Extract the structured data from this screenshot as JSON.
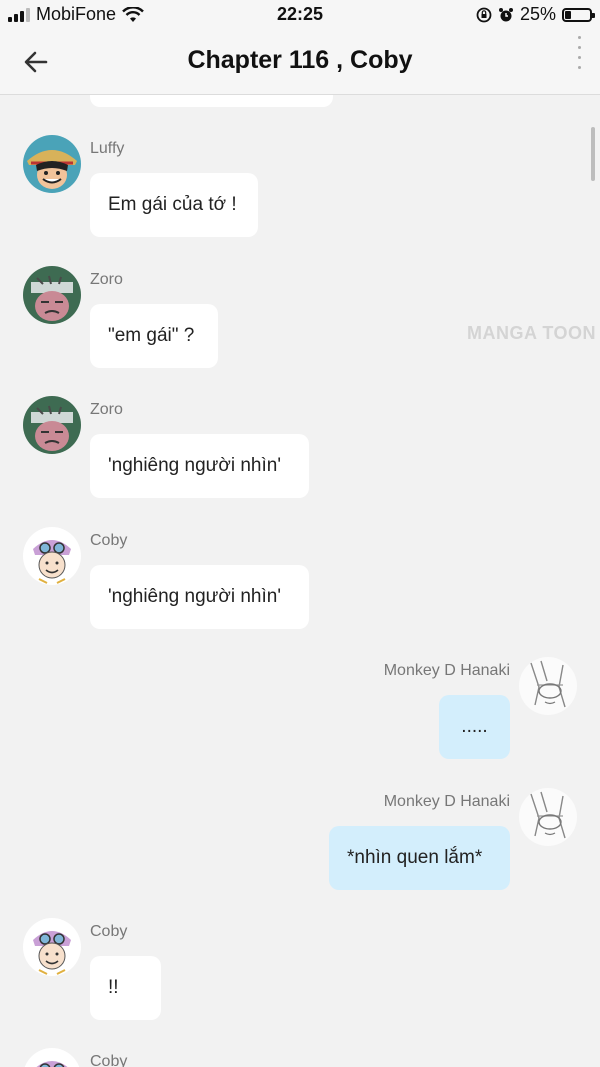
{
  "status_bar": {
    "carrier": "MobiFone",
    "time": "22:25",
    "battery_percent": "25%",
    "battery_level": 0.25
  },
  "header": {
    "title": "Chapter 116 , Coby"
  },
  "watermark": "MANGA TOON",
  "messages": [
    {
      "sender": "Luffy",
      "text": "Em gái của tớ !",
      "mine": false
    },
    {
      "sender": "Zoro",
      "text": "\"em gái\" ?",
      "mine": false
    },
    {
      "sender": "Zoro",
      "text": "'nghiêng người nhìn'",
      "mine": false
    },
    {
      "sender": "Coby",
      "text": "'nghiêng người nhìn'",
      "mine": false
    },
    {
      "sender": "Monkey D Hanaki",
      "text": ".....",
      "mine": true
    },
    {
      "sender": "Monkey D Hanaki",
      "text": "*nhìn quen lắm*",
      "mine": true
    },
    {
      "sender": "Coby",
      "text": "!!",
      "mine": false
    },
    {
      "sender": "Coby",
      "text": "",
      "mine": false
    }
  ],
  "colors": {
    "background": "#f2f2f2",
    "bubble_other": "#ffffff",
    "bubble_mine": "#d3eefc"
  }
}
